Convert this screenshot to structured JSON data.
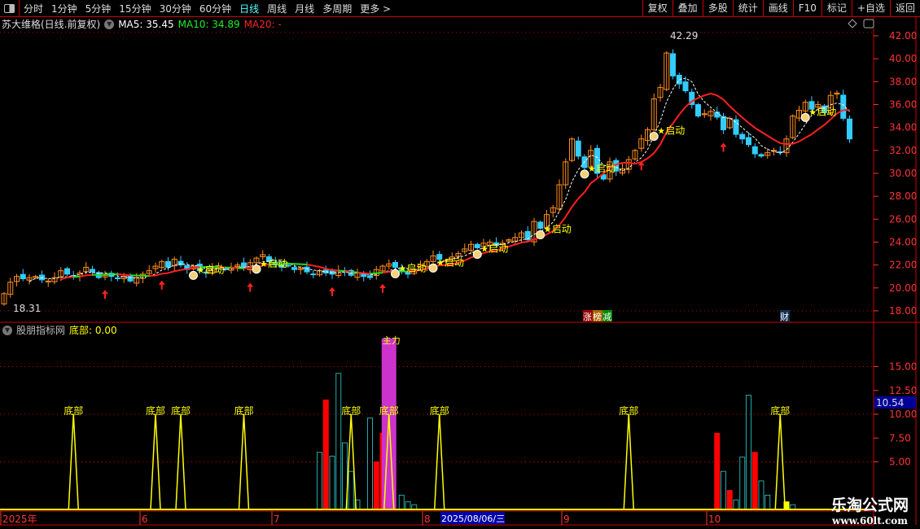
{
  "toolbar": {
    "periods": [
      "分时",
      "1分钟",
      "5分钟",
      "15分钟",
      "30分钟",
      "60分钟",
      "日线",
      "周线",
      "月线",
      "多周期",
      "更多 >"
    ],
    "active": "日线",
    "buttons": [
      "复权",
      "叠加",
      "多股",
      "统计",
      "画线",
      "F10",
      "标记",
      "+自选",
      "返回"
    ]
  },
  "header": {
    "stock": "苏大维格(日线.前复权)",
    "ma5": "MA5: 35.45",
    "ma10": "MA10: 34.89",
    "ma20": "MA20: -"
  },
  "indicator": {
    "name": "股朋指标网",
    "value": "底部: 0.00",
    "signal_label": "底部",
    "main_label": "主力",
    "current_value": "10.54"
  },
  "labels": {
    "high": "42.29",
    "low": "18.31",
    "qidong": "启动",
    "tag1": [
      "涨",
      "榜",
      "减"
    ],
    "tag2": "财"
  },
  "axis": {
    "dates": [
      "2025年",
      "6",
      "7",
      "8",
      "2025/08/06/三",
      "9",
      "10"
    ]
  },
  "watermark": {
    "name": "乐淘公式网",
    "url": "www.60lt.com"
  },
  "colors": {
    "up": "#ff8c1a",
    "down": "#33ccff",
    "ma20_up": "#ff2020",
    "ma20_flat": "#22dd22",
    "grid": "#c00",
    "signal": "#ffff00"
  },
  "chart_data": {
    "type": "candlestick",
    "price_ticks": [
      18,
      20,
      22,
      24,
      26,
      28,
      30,
      32,
      34,
      36,
      38,
      40,
      42
    ],
    "closes": [
      19.5,
      20.5,
      21,
      20.8,
      20.9,
      21,
      20.7,
      20.6,
      20.9,
      21.5,
      21.2,
      21.0,
      21.3,
      21.8,
      21.4,
      20.9,
      21.1,
      21.0,
      20.8,
      21.0,
      20.6,
      20.9,
      21.2,
      21.5,
      21.9,
      22.3,
      21.8,
      22.5,
      22.0,
      21.6,
      21.9,
      21.5,
      21.3,
      21.7,
      21.9,
      21.6,
      21.8,
      22.0,
      21.7,
      22.2,
      22.6,
      22.9,
      22.3,
      22.0,
      21.8,
      21.9,
      21.6,
      21.7,
      21.4,
      21.2,
      21.5,
      21.3,
      21.2,
      21.5,
      21.4,
      21.1,
      21.3,
      21.0,
      20.9,
      21.6,
      21.9,
      22.1,
      21.8,
      21.4,
      21.2,
      21.6,
      22.0,
      22.3,
      22.8,
      22.5,
      22.4,
      22.7,
      23.0,
      23.4,
      23.8,
      23.5,
      23.9,
      24.0,
      23.7,
      23.9,
      24.2,
      24.4,
      24.8,
      24.2,
      25.8,
      25.2,
      26.4,
      27.0,
      29.0,
      31,
      33,
      31.5,
      30.5,
      32,
      30,
      29.5,
      31,
      30.2,
      30.4,
      31.2,
      32,
      33,
      33.8,
      36.5,
      37.5,
      40.5,
      38.5,
      37.8,
      37.2,
      36.0,
      35.0,
      35.2,
      35.4,
      34.9,
      33.8,
      34.8,
      33.4,
      33.0,
      32.5,
      31.7,
      31.5,
      31.8,
      32.0,
      31.8,
      33.0,
      35.0,
      35.5,
      36.2,
      35.6,
      36.0,
      35.3,
      36.8,
      37.0,
      34.8,
      33.0
    ],
    "open_first": 18.6,
    "up_arrows": [
      16,
      25,
      39,
      52,
      60,
      101,
      114
    ],
    "qidong": [
      30,
      40,
      62,
      68,
      75,
      85,
      92,
      103,
      127
    ],
    "ind_ticks": [
      5,
      7.5,
      10,
      12.5,
      15
    ],
    "bottom_signals": [
      11,
      24,
      28,
      38,
      55,
      61,
      69,
      99,
      123
    ],
    "signal_level": 10,
    "bars": [
      {
        "i": 50,
        "v": 6,
        "c": "teal"
      },
      {
        "i": 51,
        "v": 11.5,
        "c": "red"
      },
      {
        "i": 52,
        "v": 5.6,
        "c": "teal"
      },
      {
        "i": 53,
        "v": 14.3,
        "c": "teal"
      },
      {
        "i": 54,
        "v": 7,
        "c": "teal"
      },
      {
        "i": 55,
        "v": 4,
        "c": "teal"
      },
      {
        "i": 56,
        "v": 1,
        "c": "teal"
      },
      {
        "i": 58,
        "v": 9.6,
        "c": "teal"
      },
      {
        "i": 59,
        "v": 5,
        "c": "red"
      },
      {
        "i": 60,
        "v": 8,
        "c": "red"
      },
      {
        "i": 63,
        "v": 1.5,
        "c": "teal"
      },
      {
        "i": 64,
        "v": 0.8,
        "c": "teal"
      },
      {
        "i": 65,
        "v": 0.5,
        "c": "teal"
      },
      {
        "i": 113,
        "v": 8,
        "c": "red"
      },
      {
        "i": 114,
        "v": 4,
        "c": "teal"
      },
      {
        "i": 115,
        "v": 2,
        "c": "red"
      },
      {
        "i": 116,
        "v": 1,
        "c": "teal"
      },
      {
        "i": 117,
        "v": 5.5,
        "c": "teal"
      },
      {
        "i": 118,
        "v": 12,
        "c": "teal"
      },
      {
        "i": 119,
        "v": 6,
        "c": "red"
      },
      {
        "i": 120,
        "v": 3,
        "c": "teal"
      },
      {
        "i": 121,
        "v": 1.5,
        "c": "teal"
      },
      {
        "i": 124,
        "v": 0.8,
        "c": "yellow"
      },
      {
        "i": 125,
        "v": 0.5,
        "c": "teal"
      }
    ],
    "main_column": {
      "i": 61,
      "v": 18
    }
  }
}
